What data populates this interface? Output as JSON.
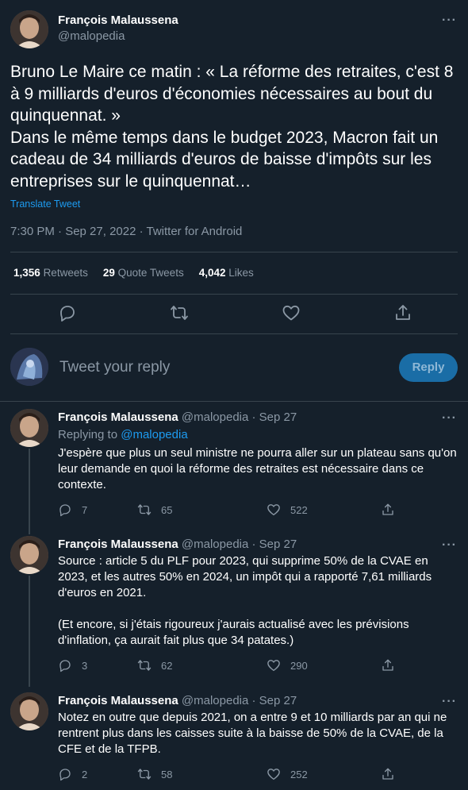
{
  "main_tweet": {
    "author_name": "François Malaussena",
    "author_handle": "@malopedia",
    "text": "Bruno Le Maire ce matin : « La réforme des retraites, c'est 8 à 9 milliards d'euros d'économies nécessaires au bout du quinquennat. »\nDans le même temps dans le budget 2023, Macron fait un cadeau de 34 milliards d'euros de baisse d'impôts sur les entreprises sur le quinquennat…",
    "translate_label": "Translate Tweet",
    "meta": "7:30 PM · Sep 27, 2022 · Twitter for Android",
    "retweets_count": "1,356",
    "retweets_label": "Retweets",
    "quotes_count": "29",
    "quotes_label": "Quote Tweets",
    "likes_count": "4,042",
    "likes_label": "Likes"
  },
  "reply_box": {
    "placeholder": "Tweet your reply",
    "button_label": "Reply"
  },
  "replies": [
    {
      "author_name": "François Malaussena",
      "handle_date": "@malopedia · Sep 27",
      "replying_prefix": "Replying to",
      "replying_handle": "@malopedia",
      "text": "J'espère que plus un seul ministre ne pourra aller sur un plateau sans qu'on leur demande en quoi la réforme des retraites est nécessaire dans ce contexte.",
      "replies": "7",
      "retweets": "65",
      "likes": "522"
    },
    {
      "author_name": "François Malaussena",
      "handle_date": "@malopedia · Sep 27",
      "text": "Source : article 5 du PLF pour 2023, qui supprime 50% de la CVAE en 2023, et les autres 50% en 2024, un impôt qui a rapporté 7,61 milliards d'euros en 2021.\n\n(Et encore, si j'étais rigoureux j'aurais actualisé avec les prévisions d'inflation, ça aurait fait plus que 34 patates.)",
      "replies": "3",
      "retweets": "62",
      "likes": "290"
    },
    {
      "author_name": "François Malaussena",
      "handle_date": "@malopedia · Sep 27",
      "text": "Notez en outre que depuis 2021, on a entre 9 et 10 milliards par an qui ne rentrent plus dans les caisses suite à la baisse de 50% de la CVAE, de la CFE et de la TFPB.",
      "replies": "2",
      "retweets": "58",
      "likes": "252"
    }
  ],
  "icons": {
    "reply": "reply-icon",
    "retweet": "retweet-icon",
    "like": "heart-icon",
    "share": "share-icon",
    "more": "more-icon"
  },
  "colors": {
    "background": "#15202b",
    "accent": "#1d9bf0",
    "muted": "#8b98a5",
    "divider": "#38444d"
  }
}
